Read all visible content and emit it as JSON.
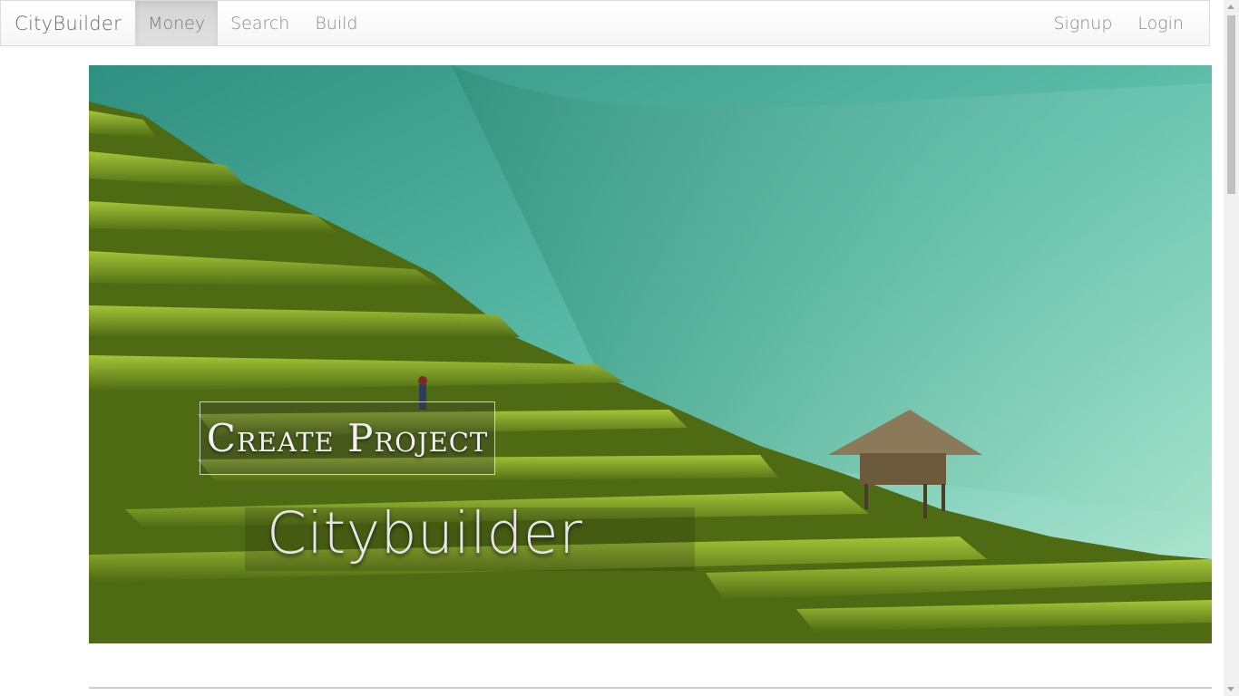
{
  "navbar": {
    "brand": "CityBuilder",
    "items": [
      {
        "label": "Money",
        "active": true
      },
      {
        "label": "Search",
        "active": false
      },
      {
        "label": "Build",
        "active": false
      }
    ],
    "right_items": [
      {
        "label": "Signup"
      },
      {
        "label": "Login"
      }
    ]
  },
  "hero": {
    "create_button": "Create Project",
    "title": "Citybuilder",
    "image": "rice-terraces-image"
  },
  "colors": {
    "navbar_bg": "#f8f8f8",
    "active_bg": "#dadada",
    "hero_sky": "#6cc8b4",
    "terrace_green": "#7fa82a"
  }
}
